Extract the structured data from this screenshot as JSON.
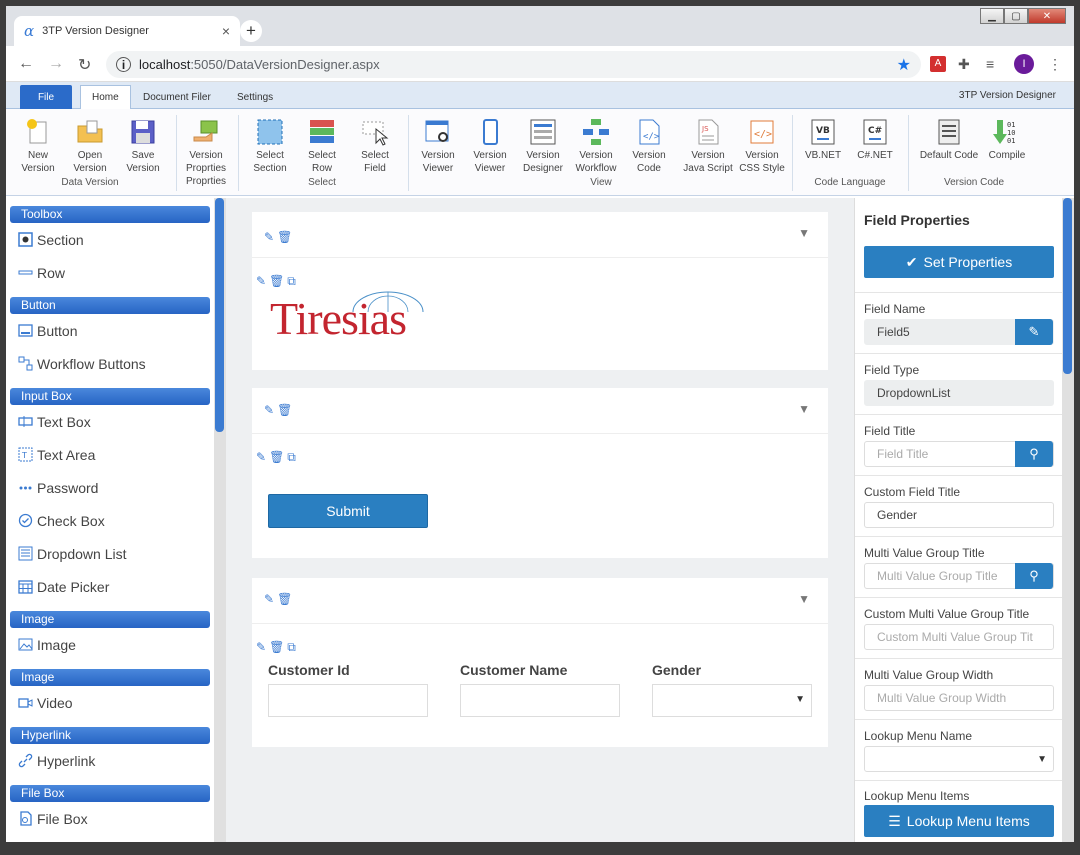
{
  "browser": {
    "tab_title": "3TP Version Designer",
    "tab_icon": "α",
    "url_host": "localhost",
    "url_path": ":5050/DataVersionDesigner.aspx",
    "profile_initial": "I",
    "profile_color": "#6a1b9a"
  },
  "ribbon": {
    "tabs": [
      "File",
      "Home",
      "Document Filer",
      "Settings"
    ],
    "app_title": "3TP Version Designer",
    "buttons": [
      {
        "l1": "New",
        "l2": "Version"
      },
      {
        "l1": "Open",
        "l2": "Version"
      },
      {
        "l1": "Save",
        "l2": "Version"
      },
      {
        "l1": "Version",
        "l2": "Proprties",
        "l3": "Proprties"
      },
      {
        "l1": "Select",
        "l2": "Section"
      },
      {
        "l1": "Select",
        "l2": "Row"
      },
      {
        "l1": "Select",
        "l2": "Field"
      },
      {
        "l1": "Version",
        "l2": "Viewer"
      },
      {
        "l1": "Version",
        "l2": "Viewer"
      },
      {
        "l1": "Version",
        "l2": "Designer"
      },
      {
        "l1": "Version",
        "l2": "Workflow"
      },
      {
        "l1": "Version",
        "l2": "Code"
      },
      {
        "l1": "Version",
        "l2": "Java Script"
      },
      {
        "l1": "Version",
        "l2": "CSS Style"
      },
      {
        "l1": "VB.NET",
        "l2": ""
      },
      {
        "l1": "C#.NET",
        "l2": ""
      },
      {
        "l1": "Default Code",
        "l2": ""
      },
      {
        "l1": "Compile",
        "l2": ""
      }
    ],
    "groups": [
      "Data Version",
      "Select",
      "View",
      "Code Language",
      "Version Code"
    ]
  },
  "toolbox": {
    "headers": [
      "Toolbox",
      "Button",
      "Input Box",
      "Image",
      "Image",
      "Hyperlink",
      "File Box"
    ],
    "items": [
      "Section",
      "Row",
      "Button",
      "Workflow Buttons",
      "Text Box",
      "Text Area",
      "Password",
      "Check Box",
      "Dropdown List",
      "Date Picker",
      "Image",
      "Video",
      "Hyperlink",
      "File Box"
    ]
  },
  "canvas": {
    "logo": "Tiresias",
    "submit_label": "Submit",
    "fields": [
      "Customer Id",
      "Customer Name",
      "Gender"
    ]
  },
  "props": {
    "title": "Field Properties",
    "set_label": "Set Properties",
    "field_name_label": "Field Name",
    "field_name_value": "Field5",
    "field_type_label": "Field Type",
    "field_type_value": "DropdownList",
    "field_title_label": "Field Title",
    "field_title_ph": "Field Title",
    "custom_title_label": "Custom Field Title",
    "custom_title_value": "Gender",
    "mv_group_label": "Multi Value Group Title",
    "mv_group_ph": "Multi Value Group Title",
    "custom_mv_label": "Custom Multi Value Group Title",
    "custom_mv_ph": "Custom Multi Value Group Tit",
    "mv_width_label": "Multi Value Group Width",
    "mv_width_ph": "Multi Value Group Width",
    "lookup_name_label": "Lookup Menu Name",
    "lookup_items_label": "Lookup Menu Items",
    "lookup_btn": "Lookup Menu Items"
  }
}
